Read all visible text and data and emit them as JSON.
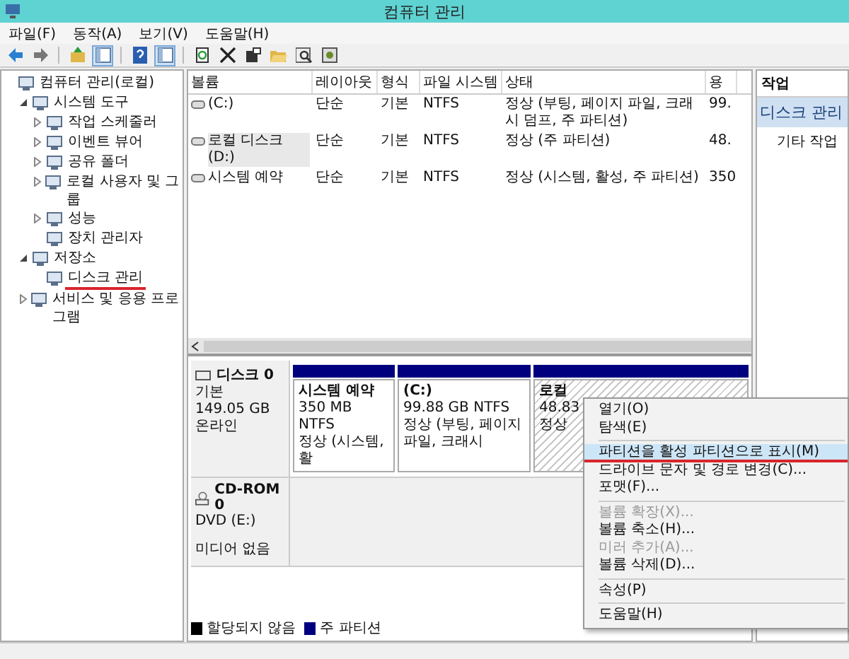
{
  "window": {
    "title": "컴퓨터 관리"
  },
  "menu_bar": [
    "파일(F)",
    "동작(A)",
    "보기(V)",
    "도움말(H)"
  ],
  "toolbar": [
    {
      "kind": "back"
    },
    {
      "kind": "forward"
    },
    {
      "kind": "separator"
    },
    {
      "kind": "up"
    },
    {
      "kind": "pane",
      "pressed": true
    },
    {
      "kind": "separator"
    },
    {
      "kind": "help"
    },
    {
      "kind": "pane",
      "pressed": true
    },
    {
      "kind": "separator"
    },
    {
      "kind": "export"
    },
    {
      "kind": "delete"
    },
    {
      "kind": "properties"
    },
    {
      "kind": "open"
    },
    {
      "kind": "find"
    },
    {
      "kind": "settings"
    }
  ],
  "tree": [
    {
      "label": "컴퓨터 관리(로컬)",
      "underlined": false,
      "children": [
        {
          "label": "시스템 도구",
          "expanded": true,
          "underlined": false,
          "children": [
            {
              "label": "작업 스케줄러",
              "expanded": false,
              "underlined": false
            },
            {
              "label": "이벤트 뷰어",
              "expanded": false,
              "underlined": false
            },
            {
              "label": "공유 폴더",
              "expanded": false,
              "underlined": false
            },
            {
              "label": "로컬 사용자 및 그룹",
              "expanded": false,
              "underlined": false
            },
            {
              "label": "성능",
              "expanded": false,
              "underlined": false
            },
            {
              "label": "장치 관리자",
              "underlined": false
            }
          ]
        },
        {
          "label": "저장소",
          "expanded": true,
          "underlined": false,
          "children": [
            {
              "label": "디스크 관리",
              "underlined": true
            }
          ]
        },
        {
          "label": "서비스 및 응용 프로그램",
          "expanded": false,
          "underlined": false
        }
      ]
    }
  ],
  "table": {
    "columns": [
      "볼륨",
      "레이아웃",
      "형식",
      "파일 시스템",
      "상태",
      "용"
    ],
    "rows": [
      {
        "selected": false,
        "cells": [
          "(C:)",
          "단순",
          "기본",
          "NTFS",
          "정상 (부팅, 페이지 파일, 크래시 덤프, 주 파티션)",
          "99."
        ]
      },
      {
        "selected": true,
        "cells": [
          "로컬 디스크 (D:)",
          "단순",
          "기본",
          "NTFS",
          "정상 (주 파티션)",
          "48."
        ]
      },
      {
        "selected": false,
        "cells": [
          "시스템 예약",
          "단순",
          "기본",
          "NTFS",
          "정상 (시스템, 활성, 주 파티션)",
          "350"
        ]
      }
    ]
  },
  "disks": [
    {
      "kind": "disk",
      "name": "디스크 0",
      "lines": [
        "기본",
        "149.05 GB",
        "온라인"
      ],
      "partitions": [
        {
          "selected": false,
          "lines": [
            "시스템 예약",
            "350 MB NTFS",
            "정상 (시스템, 활"
          ]
        },
        {
          "selected": false,
          "lines": [
            "(C:)",
            "99.88 GB NTFS",
            "정상 (부팅, 페이지 파일, 크래시"
          ]
        },
        {
          "selected": true,
          "lines": [
            "로컬",
            "48.83",
            "정상"
          ]
        }
      ]
    },
    {
      "kind": "cdrom",
      "name": "CD-ROM 0",
      "lines": [
        "DVD (E:)",
        "미디어 없음"
      ]
    }
  ],
  "legend": [
    {
      "label": "할당되지 않음",
      "color": "#000000"
    },
    {
      "label": "주 파티션",
      "color": "#00007f"
    }
  ],
  "actions": {
    "header": "작업",
    "items": [
      {
        "label": "디스크 관리",
        "kind": "section"
      },
      {
        "label": "기타 작업",
        "kind": "entry"
      }
    ]
  },
  "context_menu": {
    "groups": [
      [
        {
          "label": "열기(O)",
          "disabled": false,
          "selected": false,
          "underlined": false
        },
        {
          "label": "탐색(E)",
          "disabled": false,
          "selected": false,
          "underlined": false
        }
      ],
      [
        {
          "label": "파티션을 활성 파티션으로 표시(M)",
          "disabled": false,
          "selected": true,
          "underlined": true
        },
        {
          "label": "드라이브 문자 및 경로 변경(C)...",
          "disabled": false,
          "selected": false,
          "underlined": false
        },
        {
          "label": "포맷(F)...",
          "disabled": false,
          "selected": false,
          "underlined": false
        }
      ],
      [
        {
          "label": "볼륨 확장(X)...",
          "disabled": true,
          "selected": false,
          "underlined": false
        },
        {
          "label": "볼륨 축소(H)...",
          "disabled": false,
          "selected": false,
          "underlined": false
        },
        {
          "label": "미러 추가(A)...",
          "disabled": true,
          "selected": false,
          "underlined": false
        },
        {
          "label": "볼륨 삭제(D)...",
          "disabled": false,
          "selected": false,
          "underlined": false
        }
      ],
      [
        {
          "label": "속성(P)",
          "disabled": false,
          "selected": false,
          "underlined": false
        }
      ],
      [
        {
          "label": "도움말(H)",
          "disabled": false,
          "selected": false,
          "underlined": false
        }
      ]
    ]
  }
}
